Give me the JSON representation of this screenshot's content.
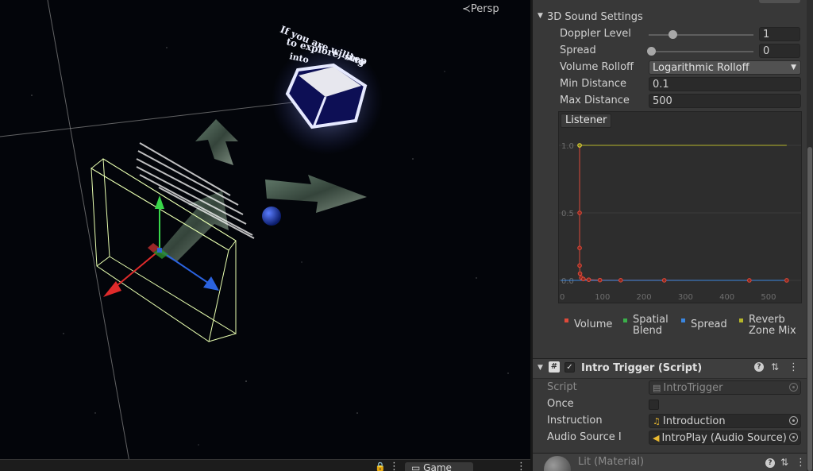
{
  "scene_view": {
    "camera_mode": "Persp",
    "sign_text_line1": "If you are willing",
    "sign_text_line2": "to explore, step",
    "sign_text_line3": "into",
    "game_tab_label": "Game"
  },
  "inspector": {
    "section_title": "3D Sound Settings",
    "fields": {
      "doppler": {
        "label": "Doppler Level",
        "value": "1",
        "level": 0.23
      },
      "spread": {
        "label": "Spread",
        "value": "0",
        "level": 0.0
      },
      "rolloff": {
        "label": "Volume Rolloff",
        "value": "Logarithmic Rolloff"
      },
      "min_distance": {
        "label": "Min Distance",
        "value": "0.1"
      },
      "max_distance": {
        "label": "Max Distance",
        "value": "500"
      }
    },
    "graph": {
      "listener_label": "Listener",
      "y_ticks": [
        "1.0",
        "0.5",
        "0.0"
      ],
      "x_ticks": [
        "0",
        "100",
        "200",
        "300",
        "400",
        "500"
      ]
    },
    "legend": [
      {
        "line1": "Volume",
        "line2": "",
        "color": "#e04a3a"
      },
      {
        "line1": "Spatial",
        "line2": "Blend",
        "color": "#3ab04a"
      },
      {
        "line1": "Spread",
        "line2": "",
        "color": "#3a86e0"
      },
      {
        "line1": "Reverb",
        "line2": "Zone Mix",
        "color": "#b5b52a"
      }
    ],
    "component": {
      "title": "Intro Trigger (Script)",
      "enabled": true,
      "script": {
        "label": "Script",
        "value": "IntroTrigger"
      },
      "once": {
        "label": "Once",
        "checked": false
      },
      "instruction": {
        "label": "Instruction",
        "value": "Introduction"
      },
      "audio_source": {
        "label": "Audio Source I",
        "value": "IntroPlay (Audio Source)"
      }
    },
    "material": {
      "title": "Lit (Material)"
    }
  },
  "chart_data": {
    "type": "line",
    "title": "",
    "xlabel": "",
    "ylabel": "",
    "xlim": [
      0,
      550
    ],
    "ylim": [
      0,
      1.1
    ],
    "x_ticks": [
      0,
      100,
      200,
      300,
      400,
      500
    ],
    "y_ticks": [
      0.0,
      0.5,
      1.0
    ],
    "series": [
      {
        "name": "Volume",
        "color": "#e04a3a",
        "x": [
          46,
          46,
          46,
          46,
          47,
          50,
          55,
          68,
          95,
          145,
          250,
          455,
          545
        ],
        "y": [
          1.0,
          0.5,
          0.24,
          0.11,
          0.05,
          0.02,
          0.01,
          0.005,
          0.002,
          0.001,
          0.0005,
          0.0002,
          0.0001
        ]
      },
      {
        "name": "Spread",
        "color": "#3a86e0",
        "x": [
          0,
          545
        ],
        "y": [
          0.0,
          0.0
        ]
      },
      {
        "name": "Reverb Zone Mix",
        "color": "#b5b52a",
        "x": [
          46,
          545
        ],
        "y": [
          1.0,
          1.0
        ]
      }
    ]
  }
}
